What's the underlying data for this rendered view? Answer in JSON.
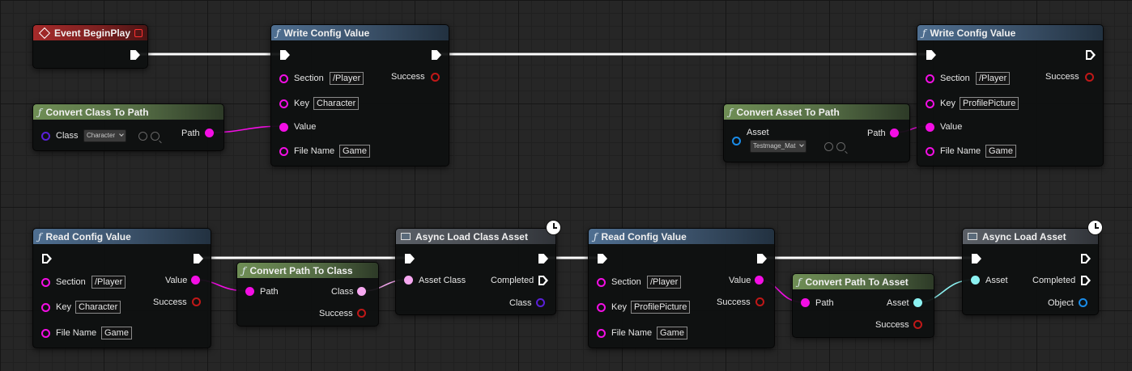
{
  "nodes": {
    "event_begin_play": {
      "title": "Event BeginPlay"
    },
    "write_config_1": {
      "title": "Write Config Value",
      "section_label": "Section",
      "section_value": "/Player",
      "key_label": "Key",
      "key_value": "Character",
      "value_label": "Value",
      "filename_label": "File Name",
      "filename_value": "Game",
      "success_label": "Success"
    },
    "convert_class_to_path": {
      "title": "Convert Class To Path",
      "class_label": "Class",
      "class_value": "Character",
      "path_label": "Path"
    },
    "convert_asset_to_path": {
      "title": "Convert Asset To Path",
      "asset_label": "Asset",
      "asset_value": "Testmage_Mat",
      "path_label": "Path"
    },
    "write_config_2": {
      "title": "Write Config Value",
      "section_label": "Section",
      "section_value": "/Player",
      "key_label": "Key",
      "key_value": "ProfilePicture",
      "value_label": "Value",
      "filename_label": "File Name",
      "filename_value": "Game",
      "success_label": "Success"
    },
    "read_config_1": {
      "title": "Read Config Value",
      "section_label": "Section",
      "section_value": "/Player",
      "key_label": "Key",
      "key_value": "Character",
      "filename_label": "File Name",
      "filename_value": "Game",
      "value_label": "Value",
      "success_label": "Success"
    },
    "convert_path_to_class": {
      "title": "Convert Path To Class",
      "path_label": "Path",
      "class_label": "Class",
      "success_label": "Success"
    },
    "async_load_class": {
      "title": "Async Load Class Asset",
      "asset_class_label": "Asset Class",
      "completed_label": "Completed",
      "class_label": "Class"
    },
    "read_config_2": {
      "title": "Read Config Value",
      "section_label": "Section",
      "section_value": "/Player",
      "key_label": "Key",
      "key_value": "ProfilePicture",
      "filename_label": "File Name",
      "filename_value": "Game",
      "value_label": "Value",
      "success_label": "Success"
    },
    "convert_path_to_asset": {
      "title": "Convert Path To Asset",
      "path_label": "Path",
      "asset_label": "Asset",
      "success_label": "Success"
    },
    "async_load_asset": {
      "title": "Async Load Asset",
      "asset_label": "Asset",
      "completed_label": "Completed",
      "object_label": "Object"
    }
  },
  "colors": {
    "exec_wire": "#ffffff",
    "soft_class_path": "#f30ee4",
    "soft_object_ref": "#8cf2f2",
    "string": "#f30ee4",
    "bool": "#c01818",
    "class": "#5a20d8",
    "object": "#1a8ce8"
  }
}
